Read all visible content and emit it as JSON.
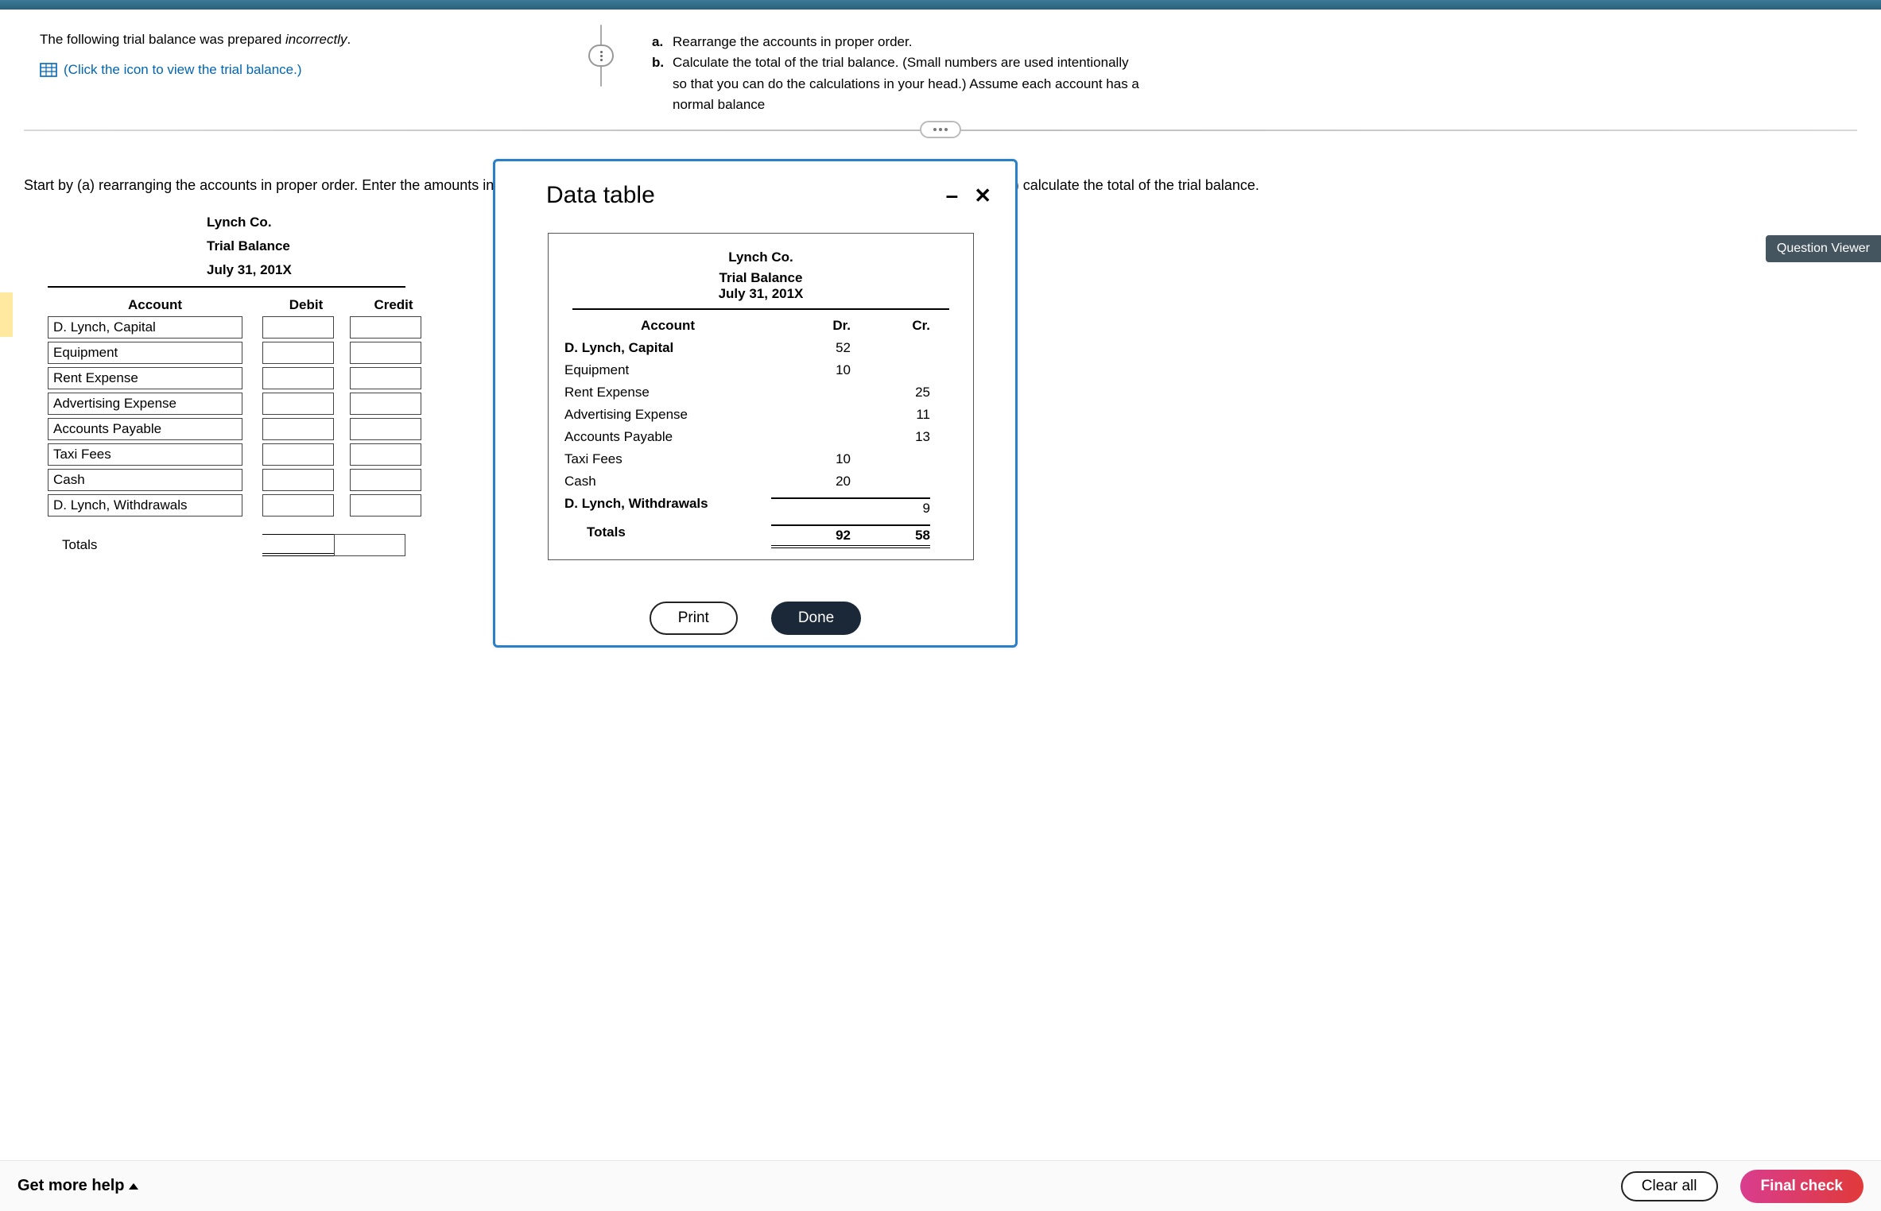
{
  "header": {
    "intro_pre": "The following trial balance was prepared ",
    "intro_em": "incorrectly",
    "intro_post": ".",
    "link": "(Click the icon to view the trial balance.)"
  },
  "requirements": [
    {
      "marker": "a.",
      "text": "Rearrange the accounts in proper order."
    },
    {
      "marker": "b.",
      "text": "Calculate the total of the trial balance. (Small numbers are used intentionally so that you can do the calculations in your head.) Assume each account has a normal balance"
    }
  ],
  "instruction": "Start by (a) rearranging the accounts in proper order. Enter the amounts into the trial balance assuming that each account has a normal balance, and then (b) calculate the total of the trial balance.",
  "trial_balance": {
    "company": "Lynch Co.",
    "title": "Trial Balance",
    "date": "July 31, 201X",
    "col_account": "Account",
    "col_debit": "Debit",
    "col_credit": "Credit",
    "accounts": [
      "D. Lynch, Capital",
      "Equipment",
      "Rent Expense",
      "Advertising Expense",
      "Accounts Payable",
      "Taxi Fees",
      "Cash",
      "D. Lynch, Withdrawals"
    ],
    "totals_label": "Totals"
  },
  "modal": {
    "title": "Data table",
    "company": "Lynch Co.",
    "subtitle": "Trial Balance",
    "date": "July 31, 201X",
    "col_account": "Account",
    "col_dr": "Dr.",
    "col_cr": "Cr.",
    "rows": [
      {
        "account": "D. Lynch, Capital",
        "dr": "52",
        "cr": "",
        "bold": true
      },
      {
        "account": "Equipment",
        "dr": "10",
        "cr": "",
        "bold": false
      },
      {
        "account": "Rent Expense",
        "dr": "",
        "cr": "25",
        "bold": false
      },
      {
        "account": "Advertising Expense",
        "dr": "",
        "cr": "11",
        "bold": false
      },
      {
        "account": "Accounts Payable",
        "dr": "",
        "cr": "13",
        "bold": false
      },
      {
        "account": "Taxi Fees",
        "dr": "10",
        "cr": "",
        "bold": false
      },
      {
        "account": "Cash",
        "dr": "20",
        "cr": "",
        "bold": false
      },
      {
        "account": "D. Lynch, Withdrawals",
        "dr": "",
        "cr": "9",
        "bold": true
      }
    ],
    "totals_label": "Totals",
    "total_dr": "92",
    "total_cr": "58",
    "print": "Print",
    "done": "Done"
  },
  "qv": "Question Viewer",
  "footer": {
    "get_more_help": "Get more help",
    "clear_all": "Clear all",
    "final_check": "Final check"
  },
  "chart_data": {
    "type": "table",
    "title": "Lynch Co. Trial Balance July 31, 201X",
    "columns": [
      "Account",
      "Dr.",
      "Cr."
    ],
    "rows": [
      [
        "D. Lynch, Capital",
        52,
        null
      ],
      [
        "Equipment",
        10,
        null
      ],
      [
        "Rent Expense",
        null,
        25
      ],
      [
        "Advertising Expense",
        null,
        11
      ],
      [
        "Accounts Payable",
        null,
        13
      ],
      [
        "Taxi Fees",
        10,
        null
      ],
      [
        "Cash",
        20,
        null
      ],
      [
        "D. Lynch, Withdrawals",
        null,
        9
      ]
    ],
    "totals": {
      "Dr.": 92,
      "Cr.": 58
    }
  }
}
